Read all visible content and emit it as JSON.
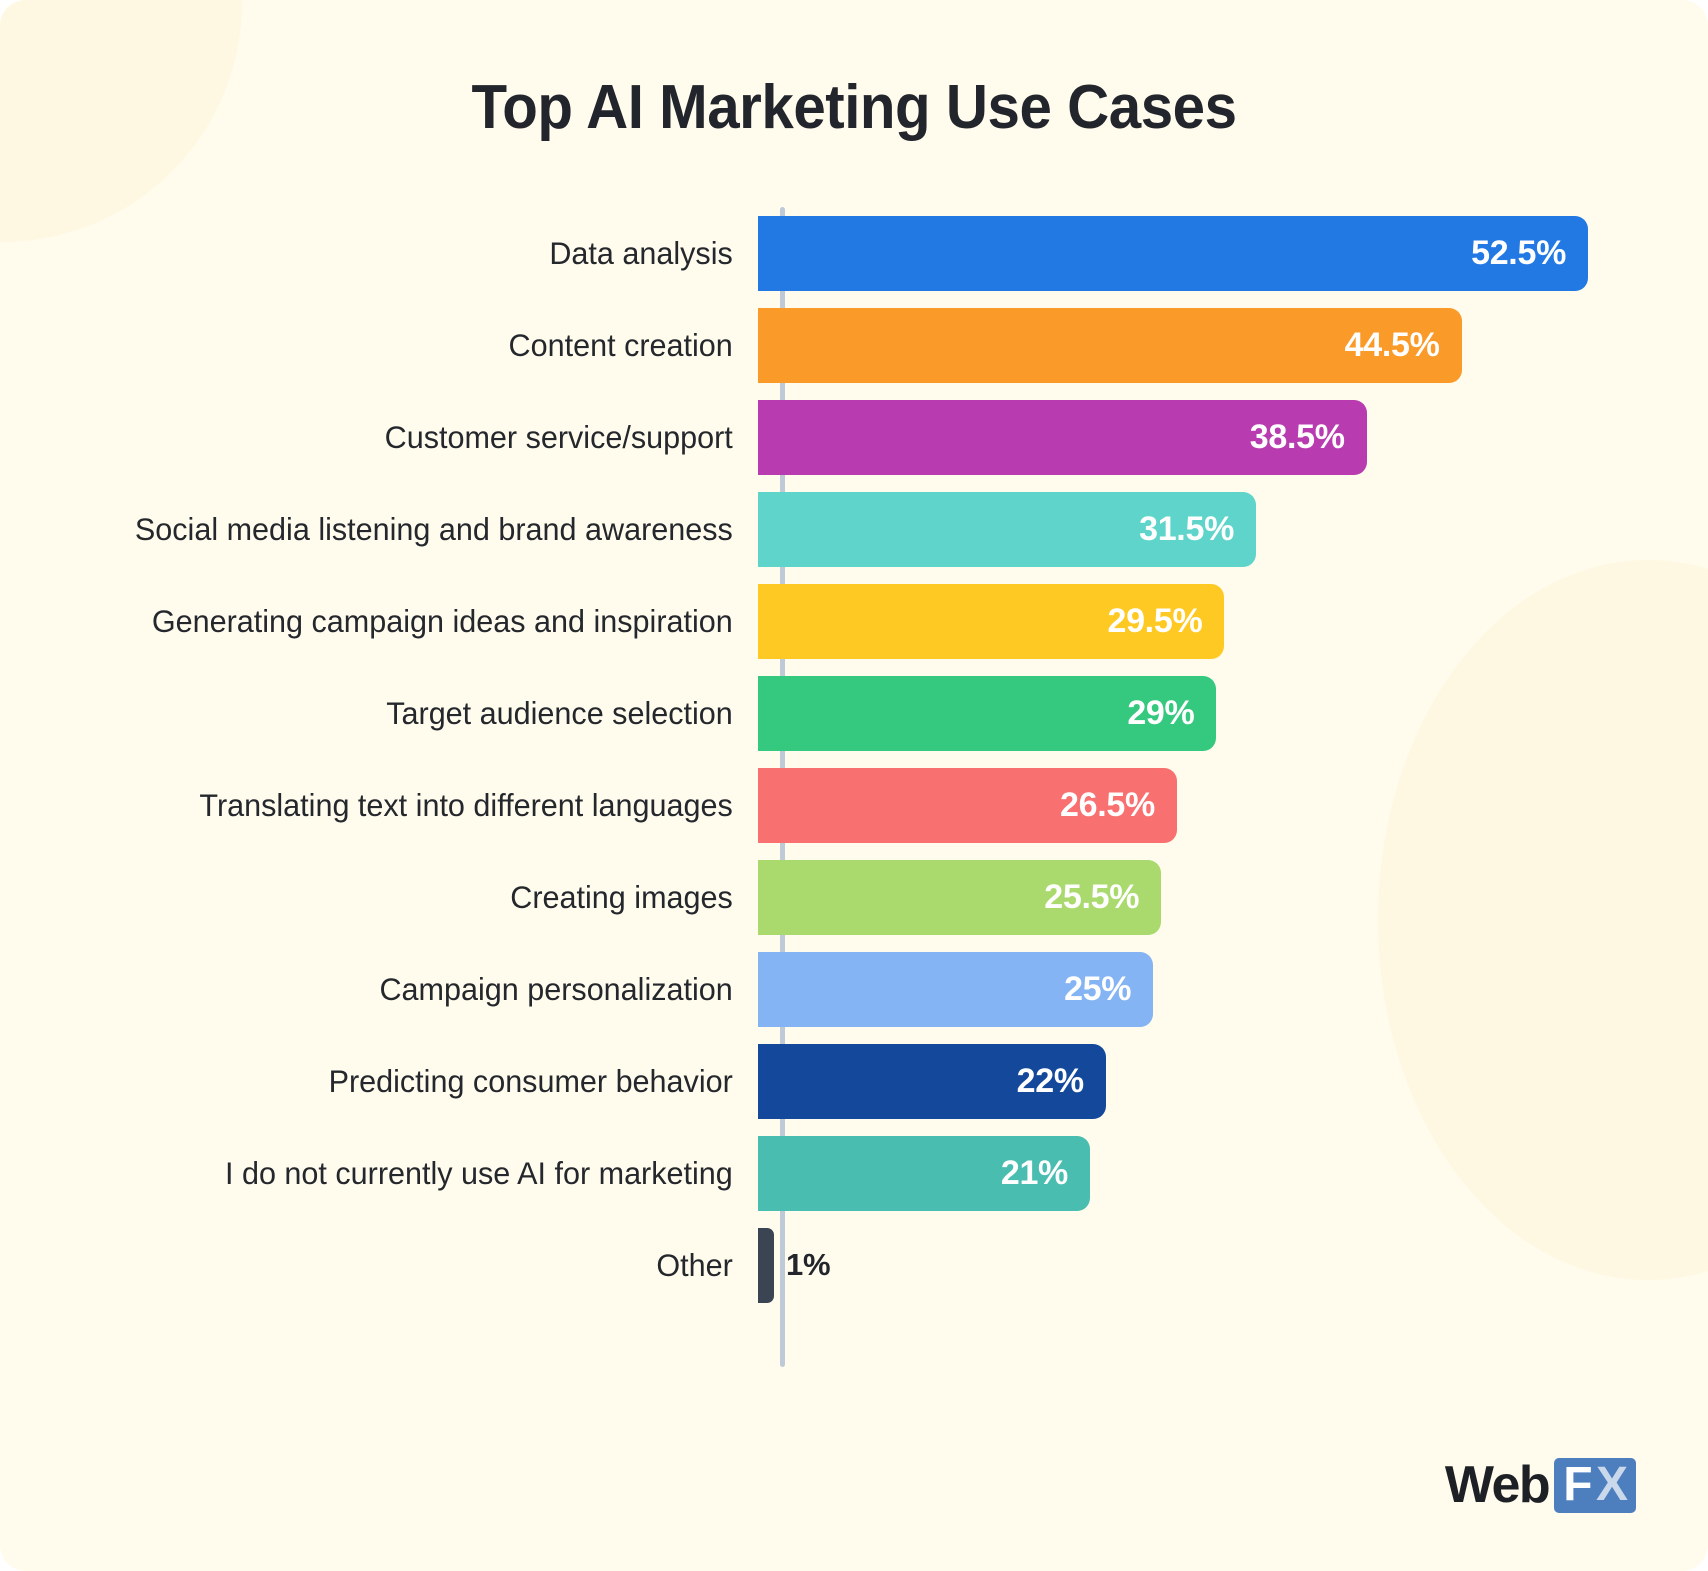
{
  "header": {
    "title": "Top AI Marketing Use Cases"
  },
  "brand": {
    "name_web": "Web",
    "name_f": "F",
    "name_x": "X",
    "logo_blue": "#4d7ebe",
    "logo_dark": "#1d2025"
  },
  "theme": {
    "background": "#fffcee",
    "decoration": "#fdf5dd",
    "axis_line": "#bfcad8",
    "title_color": "#22252b",
    "label_color": "#24272c",
    "value_color_inside": "#ffffff",
    "value_color_outside": "#22252b"
  },
  "chart_data": {
    "type": "bar",
    "orientation": "horizontal",
    "title": "Top AI Marketing Use Cases",
    "xlabel": "",
    "ylabel": "",
    "grid": false,
    "legend": "none",
    "xlim": [
      0,
      52.5
    ],
    "unit": "%",
    "categories": [
      "Data analysis",
      "Content creation",
      "Customer service/support",
      "Social media listening and brand awareness",
      "Generating campaign ideas and inspiration",
      "Target audience selection",
      "Translating text into different languages",
      "Creating images",
      "Campaign personalization",
      "Predicting consumer behavior",
      "I do not currently use AI for marketing",
      "Other"
    ],
    "values": [
      52.5,
      44.5,
      38.5,
      31.5,
      29.5,
      29,
      26.5,
      25.5,
      25,
      22,
      21,
      1
    ],
    "value_labels": [
      "52.5%",
      "44.5%",
      "38.5%",
      "31.5%",
      "29.5%",
      "29%",
      "26.5%",
      "25.5%",
      "25%",
      "22%",
      "21%",
      "1%"
    ],
    "colors": [
      "#2279e3",
      "#fa9a28",
      "#b93bb0",
      "#5fd4ca",
      "#ffc923",
      "#35c87f",
      "#f8706f",
      "#aada6e",
      "#84b4f3",
      "#13489b",
      "#49bdb0",
      "#3b4453"
    ],
    "bars": [
      {
        "label": "Data analysis",
        "value": 52.5,
        "value_label": "52.5%",
        "color": "#2279e3",
        "label_inside": true
      },
      {
        "label": "Content creation",
        "value": 44.5,
        "value_label": "44.5%",
        "color": "#fa9a28",
        "label_inside": true
      },
      {
        "label": "Customer service/support",
        "value": 38.5,
        "value_label": "38.5%",
        "color": "#b93bb0",
        "label_inside": true
      },
      {
        "label": "Social media listening and brand awareness",
        "value": 31.5,
        "value_label": "31.5%",
        "color": "#5fd4ca",
        "label_inside": true
      },
      {
        "label": "Generating campaign ideas and inspiration",
        "value": 29.5,
        "value_label": "29.5%",
        "color": "#ffc923",
        "label_inside": true
      },
      {
        "label": "Target audience selection",
        "value": 29,
        "value_label": "29%",
        "color": "#35c87f",
        "label_inside": true
      },
      {
        "label": "Translating text into different languages",
        "value": 26.5,
        "value_label": "26.5%",
        "color": "#f8706f",
        "label_inside": true
      },
      {
        "label": "Creating images",
        "value": 25.5,
        "value_label": "25.5%",
        "color": "#aada6e",
        "label_inside": true
      },
      {
        "label": "Campaign personalization",
        "value": 25,
        "value_label": "25%",
        "color": "#84b4f3",
        "label_inside": true
      },
      {
        "label": "Predicting consumer behavior",
        "value": 22,
        "value_label": "22%",
        "color": "#13489b",
        "label_inside": true
      },
      {
        "label": "I do not currently use AI for marketing",
        "value": 21,
        "value_label": "21%",
        "color": "#49bdb0",
        "label_inside": true
      },
      {
        "label": "Other",
        "value": 1,
        "value_label": "1%",
        "color": "#3b4453",
        "label_inside": false
      }
    ]
  }
}
